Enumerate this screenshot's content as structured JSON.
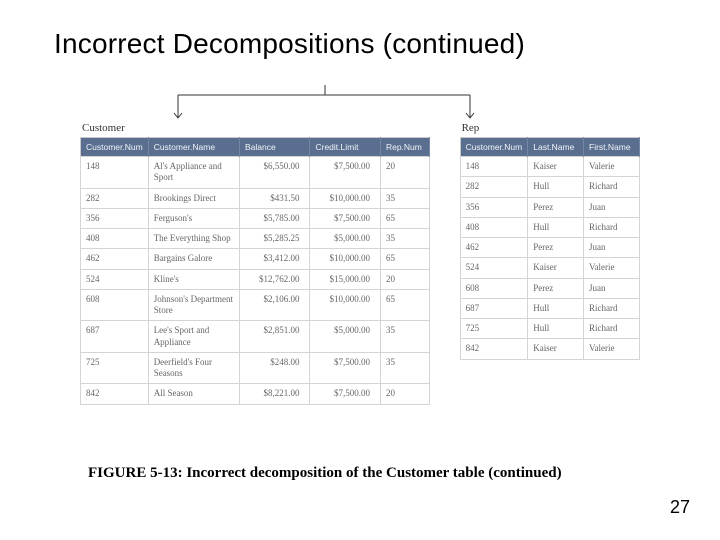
{
  "title": "Incorrect Decompositions (continued)",
  "caption": "FIGURE 5-13: Incorrect decomposition of the Customer table (continued)",
  "page_number": "27",
  "customer": {
    "label": "Customer",
    "headers": [
      "Customer.Num",
      "Customer.Name",
      "Balance",
      "Credit.Limit",
      "Rep.Num"
    ],
    "rows": [
      {
        "num": "148",
        "name": "Al's Appliance and Sport",
        "bal": "$6,550.00",
        "lim": "$7,500.00",
        "rep": "20"
      },
      {
        "num": "282",
        "name": "Brookings Direct",
        "bal": "$431.50",
        "lim": "$10,000.00",
        "rep": "35"
      },
      {
        "num": "356",
        "name": "Ferguson's",
        "bal": "$5,785.00",
        "lim": "$7,500.00",
        "rep": "65"
      },
      {
        "num": "408",
        "name": "The Everything Shop",
        "bal": "$5,285.25",
        "lim": "$5,000.00",
        "rep": "35"
      },
      {
        "num": "462",
        "name": "Bargains Galore",
        "bal": "$3,412.00",
        "lim": "$10,000.00",
        "rep": "65"
      },
      {
        "num": "524",
        "name": "Kline's",
        "bal": "$12,762.00",
        "lim": "$15,000.00",
        "rep": "20"
      },
      {
        "num": "608",
        "name": "Johnson's Department Store",
        "bal": "$2,106.00",
        "lim": "$10,000.00",
        "rep": "65"
      },
      {
        "num": "687",
        "name": "Lee's Sport and Appliance",
        "bal": "$2,851.00",
        "lim": "$5,000.00",
        "rep": "35"
      },
      {
        "num": "725",
        "name": "Deerfield's Four Seasons",
        "bal": "$248.00",
        "lim": "$7,500.00",
        "rep": "35"
      },
      {
        "num": "842",
        "name": "All Season",
        "bal": "$8,221.00",
        "lim": "$7,500.00",
        "rep": "20"
      }
    ]
  },
  "rep": {
    "label": "Rep",
    "headers": [
      "Customer.Num",
      "Last.Name",
      "First.Name"
    ],
    "rows": [
      {
        "num": "148",
        "last": "Kaiser",
        "first": "Valerie"
      },
      {
        "num": "282",
        "last": "Hull",
        "first": "Richard"
      },
      {
        "num": "356",
        "last": "Perez",
        "first": "Juan"
      },
      {
        "num": "408",
        "last": "Hull",
        "first": "Richard"
      },
      {
        "num": "462",
        "last": "Perez",
        "first": "Juan"
      },
      {
        "num": "524",
        "last": "Kaiser",
        "first": "Valerie"
      },
      {
        "num": "608",
        "last": "Perez",
        "first": "Juan"
      },
      {
        "num": "687",
        "last": "Hull",
        "first": "Richard"
      },
      {
        "num": "725",
        "last": "Hull",
        "first": "Richard"
      },
      {
        "num": "842",
        "last": "Kaiser",
        "first": "Valerie"
      }
    ]
  }
}
